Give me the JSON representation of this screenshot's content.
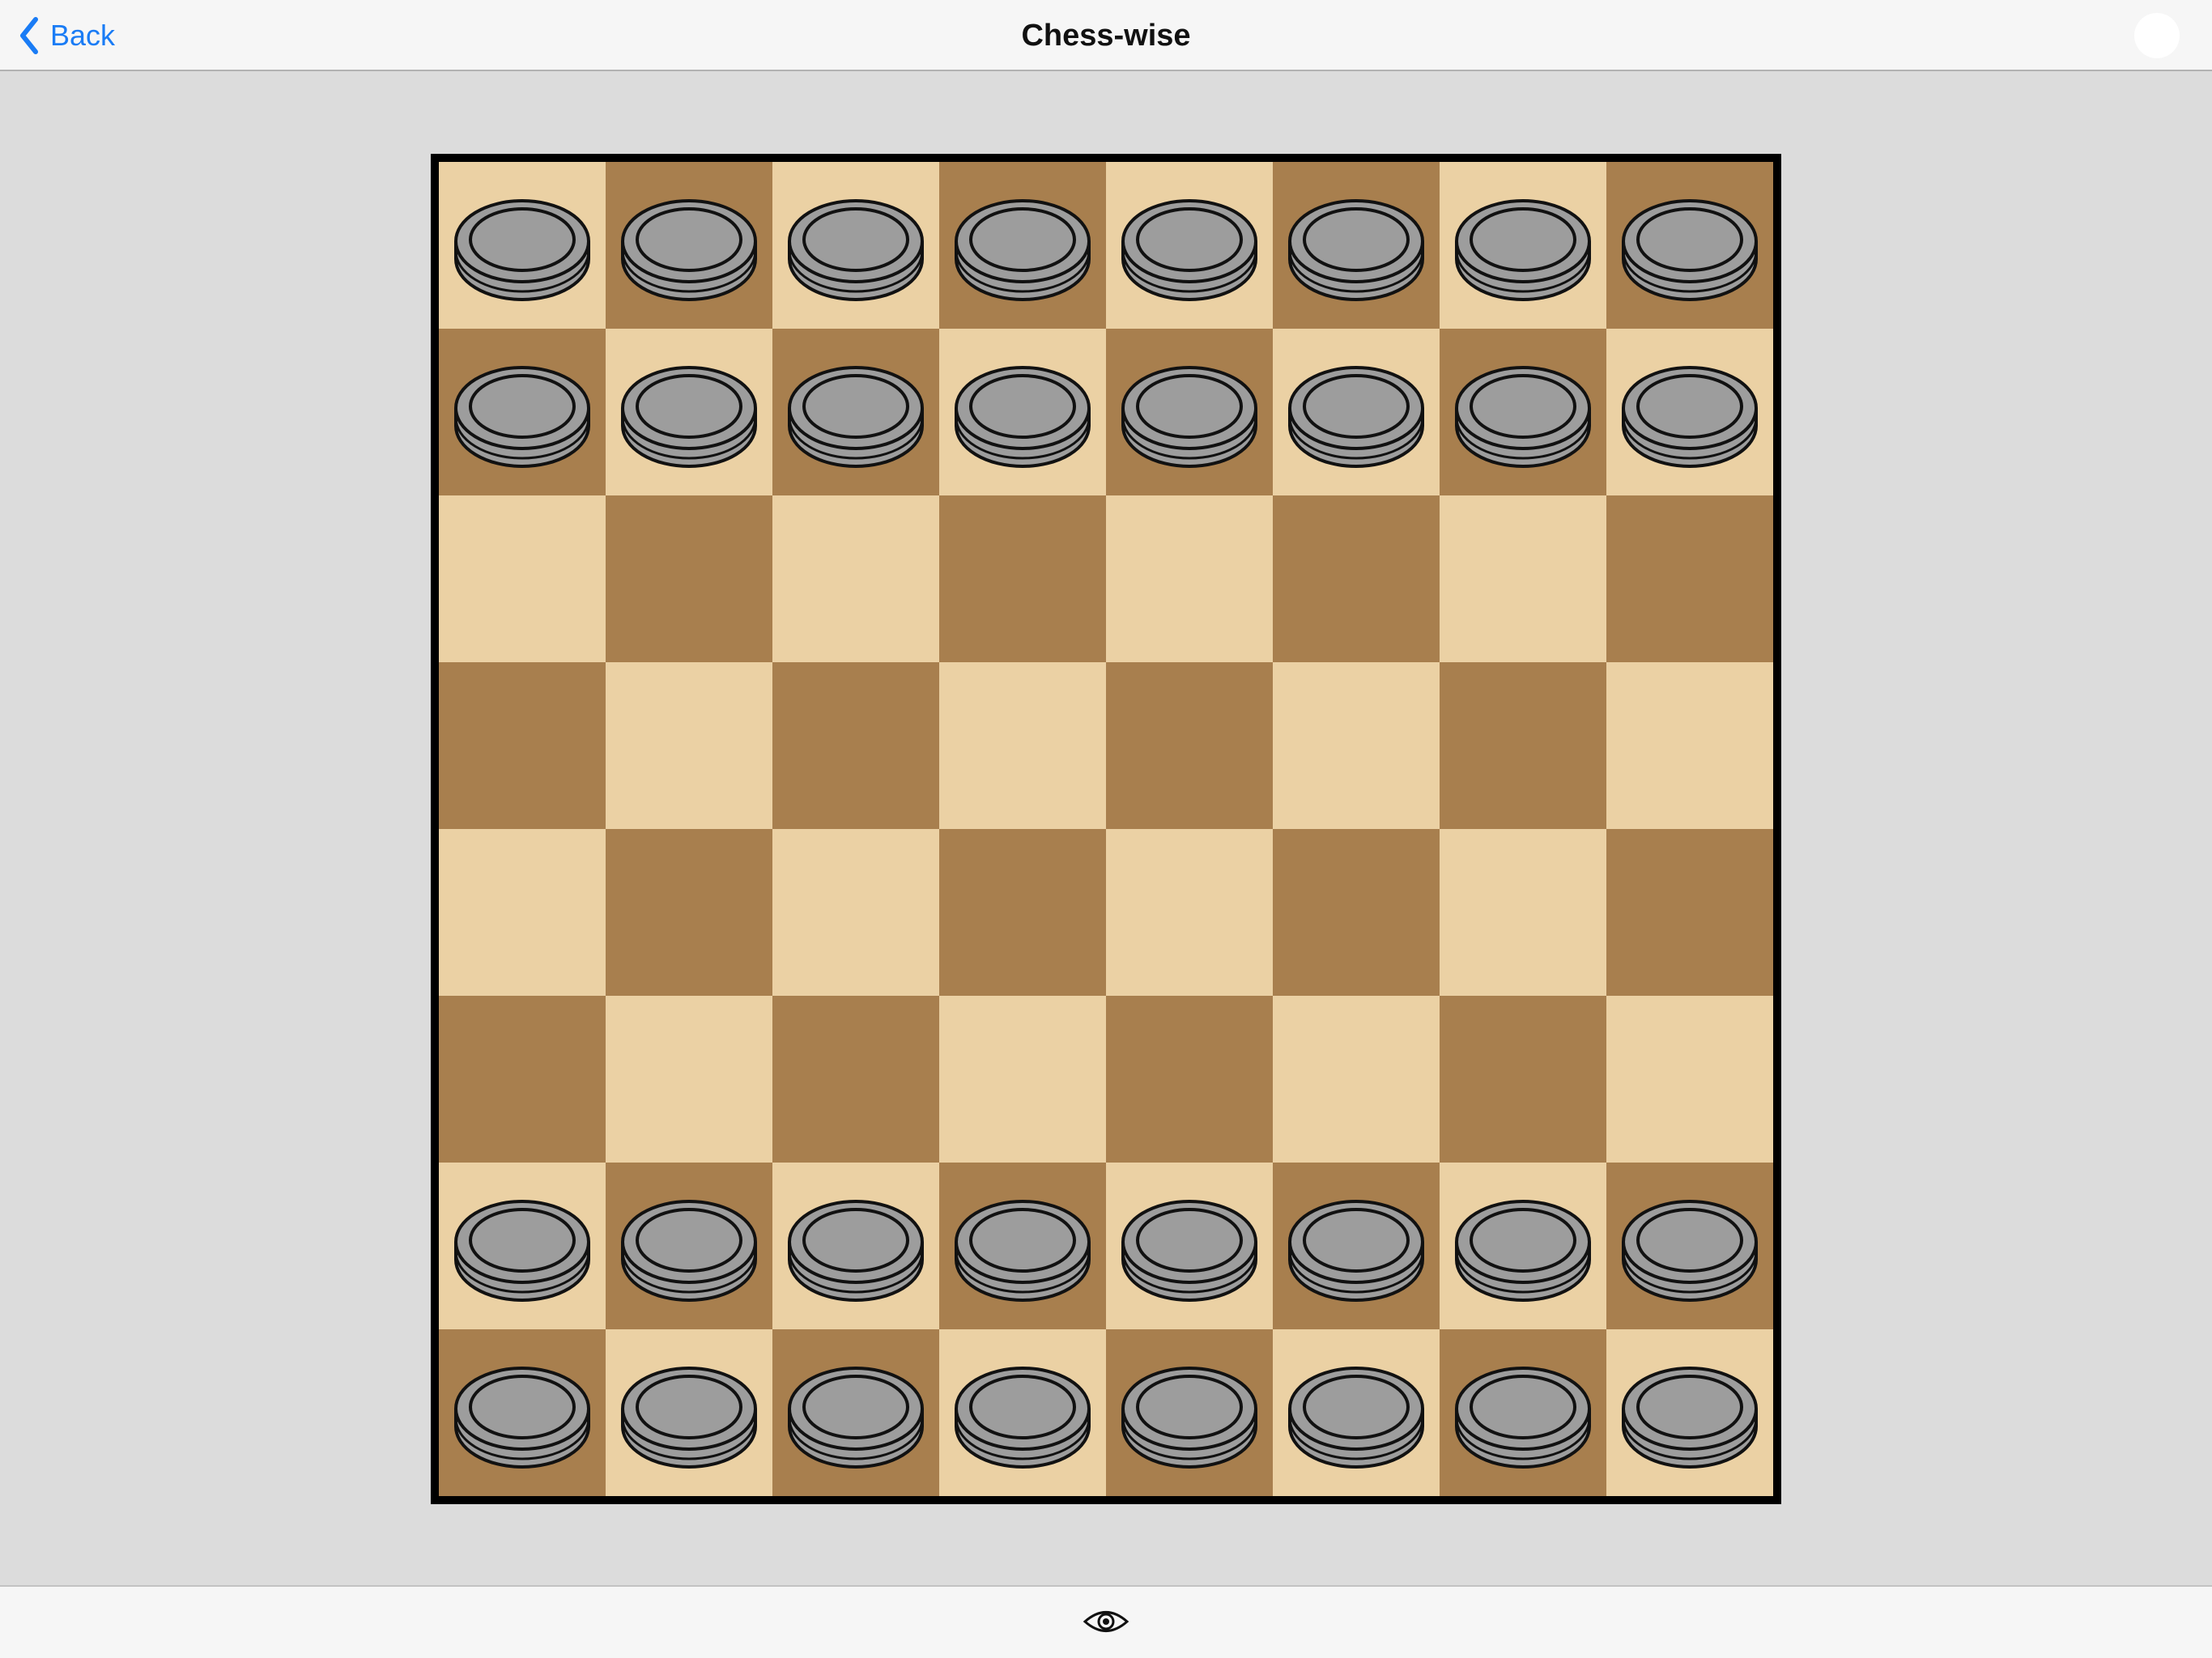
{
  "nav": {
    "back_label": "Back",
    "title": "Chess-wise"
  },
  "colors": {
    "light_square": "#ebd1a4",
    "dark_square": "#a87f4e",
    "piece_fill": "#9d9d9d",
    "piece_stroke": "#111111",
    "accent": "#1a7cf5"
  },
  "board": {
    "size": 8,
    "piece_rows": [
      0,
      1,
      6,
      7
    ]
  },
  "icons": {
    "back": "chevron-left-icon",
    "bottom": "eye-icon"
  }
}
